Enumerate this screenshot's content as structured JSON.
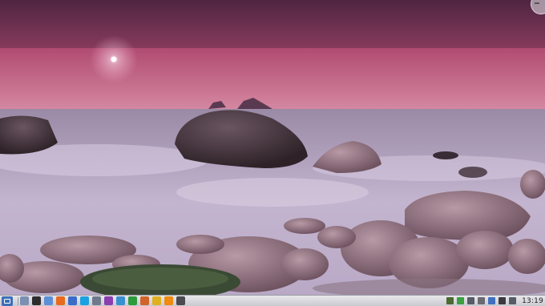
{
  "desktop": {
    "wallpaper": "pink-sunset-beach-rocks"
  },
  "taskbar": {
    "launcher_icon": "kde-menu-icon",
    "apps": [
      {
        "name": "desktop-icon",
        "color": "#7b8fb0"
      },
      {
        "name": "terminal-icon",
        "color": "#2c2c2c"
      },
      {
        "name": "files-icon",
        "color": "#5c8fd6"
      },
      {
        "name": "browser-icon",
        "color": "#e86a1c"
      },
      {
        "name": "mail-icon",
        "color": "#3a6cc8"
      },
      {
        "name": "skype-icon",
        "color": "#1ba0e0"
      },
      {
        "name": "editor-icon",
        "color": "#6e7a8c"
      },
      {
        "name": "chat-icon",
        "color": "#8a3fb0"
      },
      {
        "name": "writer-icon",
        "color": "#3a8fd0"
      },
      {
        "name": "calc-icon",
        "color": "#2e9a3e"
      },
      {
        "name": "impress-icon",
        "color": "#d0642a"
      },
      {
        "name": "draw-icon",
        "color": "#e0b020"
      },
      {
        "name": "vlc-icon",
        "color": "#f08a10"
      },
      {
        "name": "image-icon",
        "color": "#4a4a50"
      }
    ],
    "tray": [
      {
        "name": "arrows-icon",
        "color": "#4a6a30"
      },
      {
        "name": "shield-check-icon",
        "color": "#3aa040"
      },
      {
        "name": "network-icon",
        "color": "#555c66"
      },
      {
        "name": "volume-icon",
        "color": "#6a6a70"
      },
      {
        "name": "info-icon",
        "color": "#4070c0"
      },
      {
        "name": "wifi-icon",
        "color": "#3a3a40"
      },
      {
        "name": "expand-arrow-icon",
        "color": "#555c66"
      }
    ],
    "clock": "13:19"
  }
}
